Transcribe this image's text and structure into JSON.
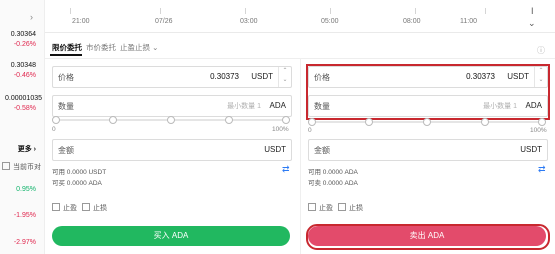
{
  "markets": {
    "rows": [
      {
        "price": "0.30364",
        "change": "-0.26%"
      },
      {
        "price": "0.30348",
        "change": "-0.46%"
      },
      {
        "price": "0.00001035",
        "change": "-0.58%"
      }
    ],
    "more_label": "更多",
    "current_pair_label": "当前币对",
    "extra_changes": [
      "0.95%",
      "-1.95%",
      "-2.97%"
    ]
  },
  "time_axis": {
    "ticks": [
      "21:00",
      "07/26",
      "03:00",
      "05:00",
      "08:00",
      "11:00"
    ]
  },
  "order_tabs": {
    "items": [
      "限价委托",
      "市价委托",
      "止盈止损"
    ],
    "active_index": 0
  },
  "buy": {
    "price_label": "价格",
    "price_value": "0.30373",
    "price_unit": "USDT",
    "qty_label": "数量",
    "qty_placeholder": "最小数量 1",
    "qty_unit": "ADA",
    "slider_min": "0",
    "slider_max": "100%",
    "amount_label": "金额",
    "amount_unit": "USDT",
    "available": "可用 0.0000 USDT",
    "can_buy": "可买 0.0000 ADA",
    "tp_label": "止盈",
    "sl_label": "止损",
    "button_label": "买入 ADA"
  },
  "sell": {
    "price_label": "价格",
    "price_value": "0.30373",
    "price_unit": "USDT",
    "qty_label": "数量",
    "qty_placeholder": "最小数量 1",
    "qty_unit": "ADA",
    "slider_min": "0",
    "slider_max": "100%",
    "amount_label": "金额",
    "amount_unit": "USDT",
    "available": "可用 0.0000 ADA",
    "can_sell": "可卖 0.0000 ADA",
    "tp_label": "止盈",
    "sl_label": "止损",
    "button_label": "卖出 ADA"
  },
  "colors": {
    "buy": "#21b860",
    "sell": "#e34b6b",
    "down": "#e0284f",
    "up": "#11b36b",
    "highlight": "#c8282f"
  }
}
